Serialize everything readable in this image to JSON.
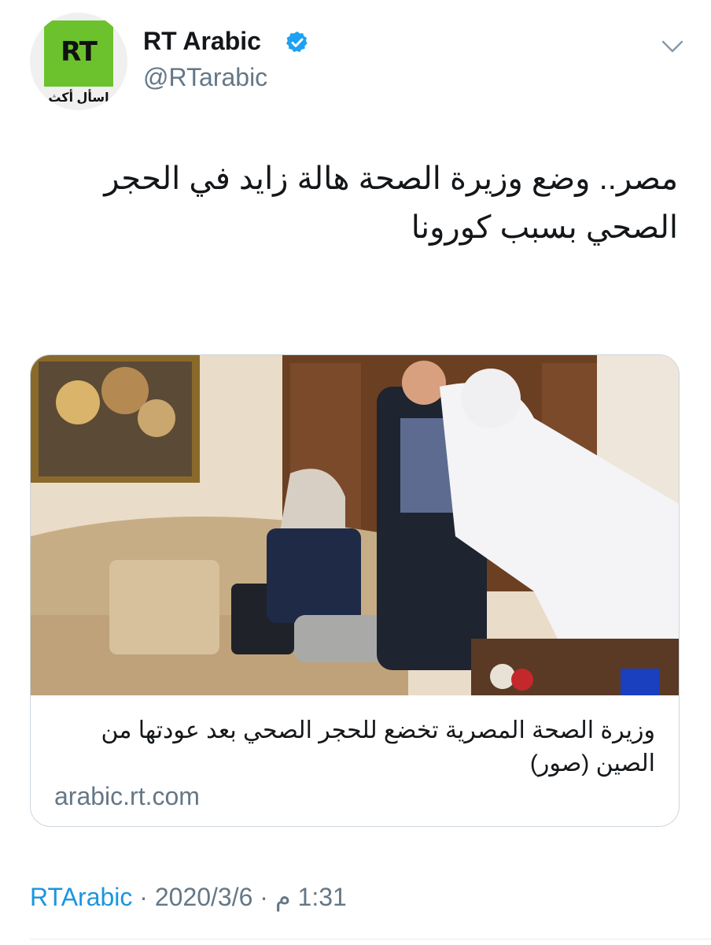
{
  "account": {
    "name": "RT Arabic",
    "handle": "@RTarabic",
    "avatar_logo": "RT",
    "avatar_tagline": "اسأل أكث"
  },
  "tweet": {
    "text": "مصر.. وضع وزيرة الصحة هالة زايد في الحجر الصحي بسبب كورونا"
  },
  "card": {
    "title": "وزيرة الصحة المصرية تخضع للحجر الصحي بعد عودتها من الصين (صور)",
    "domain": "arabic.rt.com"
  },
  "meta": {
    "source": "RTArabic",
    "separator": " · ",
    "date": "2020/3/6",
    "time": "1:31 م"
  },
  "icons": {
    "verified": "verified-badge-icon",
    "menu": "chevron-down-icon"
  },
  "colors": {
    "accent": "#1b95e0",
    "secondary_text": "#657786",
    "brand_green": "#6cc22d"
  }
}
